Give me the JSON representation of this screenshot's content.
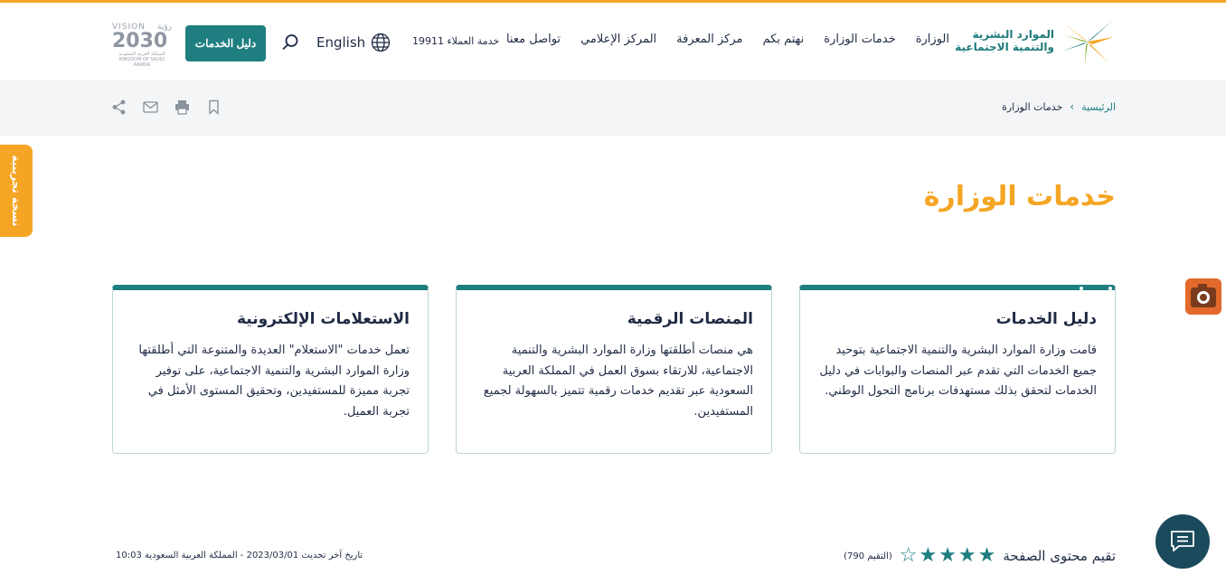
{
  "header": {
    "logo_line1": "الموارد البشرية",
    "logo_line2": "والتنمية الاجتماعية",
    "nav": [
      "الوزارة",
      "خدمات الوزارة",
      "نهتم بكم",
      "مركز المعرفة",
      "المركز الإعلامي",
      "تواصل معنا"
    ],
    "hotline": "خدمة العملاء 19911",
    "language": "English",
    "guide_button": "دليل الخدمات",
    "vision_top": "VISION",
    "vision_ar": "رؤية",
    "vision_year": "2030",
    "vision_sub1": "المملكة العربية السعودية",
    "vision_sub2": "KINGDOM OF SAUDI ARABIA"
  },
  "breadcrumb": {
    "home": "الرئيسية",
    "separator": "›",
    "current": "خدمات الوزارة"
  },
  "trial_tab": "نسخة تجريبية",
  "page_title": "خدمات الوزارة",
  "cards": [
    {
      "title": "دليل الخدمات",
      "text": "قامت وزارة الموارد البشرية والتنمية الاجتماعية بتوحيد جميع الخدمات التي تقدم عبر المنصات والبوابات في دليل الخدمات لتحقق بذلك مستهدفات برنامج التحول الوطني."
    },
    {
      "title": "المنصات الرقمية",
      "text": "هي منصات أطلقتها وزارة الموارد البشرية والتنمية الاجتماعية، للارتقاء بسوق العمل في المملكة العربية السعودية عبر تقديم خدمات رقمية تتميز بالسهولة لجميع المستفيدين."
    },
    {
      "title": "الاستعلامات الإلكترونية",
      "text": "تعمل خدمات \"الاستعلام\" العديدة والمتنوعة التي أطلقتها وزارة الموارد البشرية والتنمية الاجتماعية، على توفير تجربة مميزة للمستفيدين، وتحقيق المستوى الأمثل في تجربة العميل."
    }
  ],
  "rating": {
    "label": "تقيم محتوى الصفحة",
    "stars_filled": 4,
    "stars_total": 5,
    "count": "(التقيم 790)"
  },
  "updated": "تاريخ آخر تحديث  2023/03/01  - المملكة العربية السعودية  10:03",
  "colors": {
    "accent": "#f5a524",
    "teal": "#1e7e80",
    "dark": "#1f2a44",
    "chat": "#1a4a5c"
  }
}
